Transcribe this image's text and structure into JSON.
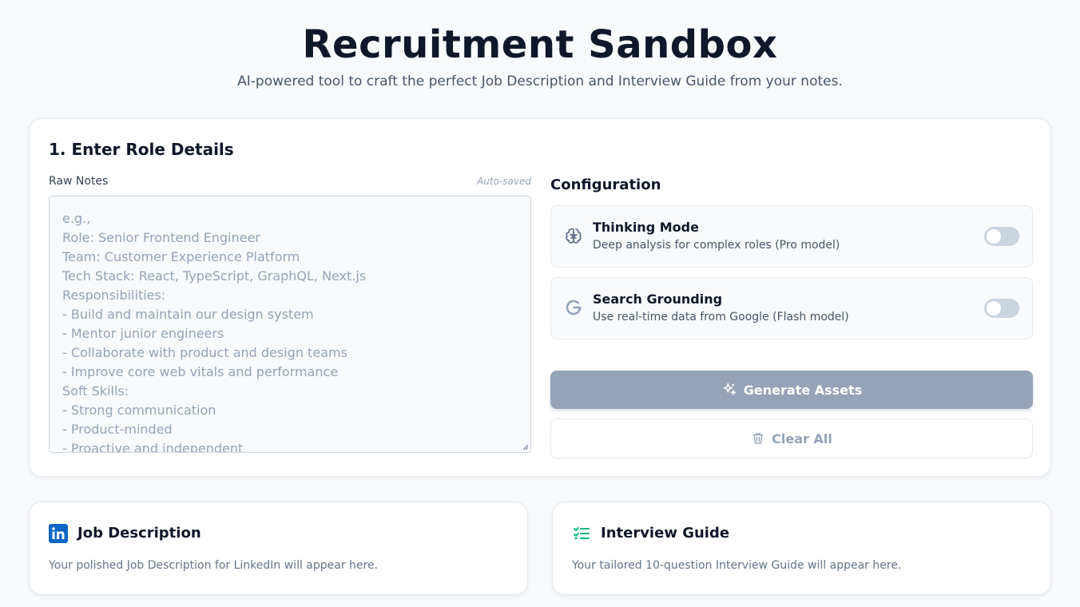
{
  "header": {
    "title": "Recruitment Sandbox",
    "subtitle": "AI-powered tool to craft the perfect Job Description and Interview Guide from your notes."
  },
  "role_details": {
    "section_title": "1. Enter Role Details",
    "notes_label": "Raw Notes",
    "autosave_status": "Auto-saved",
    "notes_value": "",
    "notes_placeholder": "e.g.,\nRole: Senior Frontend Engineer\nTeam: Customer Experience Platform\nTech Stack: React, TypeScript, GraphQL, Next.js\nResponsibilities:\n- Build and maintain our design system\n- Mentor junior engineers\n- Collaborate with product and design teams\n- Improve core web vitals and performance\nSoft Skills:\n- Strong communication\n- Product-minded\n- Proactive and independent"
  },
  "configuration": {
    "title": "Configuration",
    "options": [
      {
        "icon": "brain-icon",
        "title": "Thinking Mode",
        "description": "Deep analysis for complex roles (Pro model)",
        "enabled": false
      },
      {
        "icon": "google-g-icon",
        "title": "Search Grounding",
        "description": "Use real-time data from Google (Flash model)",
        "enabled": false
      }
    ],
    "generate_label": "Generate Assets",
    "generate_icon": "sparkles-icon",
    "clear_label": "Clear All",
    "clear_icon": "trash-icon"
  },
  "outputs": {
    "job_description": {
      "icon": "linkedin-icon",
      "title": "Job Description",
      "placeholder": "Your polished Job Description for LinkedIn will appear here."
    },
    "interview_guide": {
      "icon": "checklist-icon",
      "title": "Interview Guide",
      "placeholder": "Your tailored 10-question Interview Guide will appear here."
    }
  },
  "colors": {
    "background": "#f8fafc",
    "primary_text": "#0f172a",
    "muted_text": "#94a3b8",
    "button_disabled": "#94a3b8",
    "linkedin_blue": "#0a66c2",
    "checklist_green": "#10b981"
  }
}
